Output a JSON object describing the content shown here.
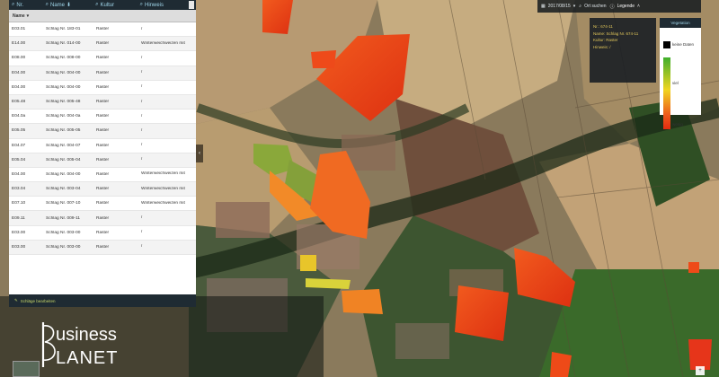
{
  "table": {
    "headers": {
      "id": "Nr.",
      "name": "Name",
      "crop": "Kultur",
      "note": "Hinweis"
    },
    "sub_header": "Name",
    "rows": [
      {
        "id": "E03.01",
        "name": "Schlag Nr. 183-01",
        "crop": "Raster",
        "note": "/"
      },
      {
        "id": "E14.00",
        "name": "Schlag Nr. 014-00",
        "crop": "Raster",
        "note": "Winterweichweizen mit"
      },
      {
        "id": "E08.00",
        "name": "Schlag Nr. 008-00",
        "crop": "Raster",
        "note": "/"
      },
      {
        "id": "E04.00",
        "name": "Schlag Nr. 004-00",
        "crop": "Raster",
        "note": "/"
      },
      {
        "id": "E04.00",
        "name": "Schlag Nr. 004-00",
        "crop": "Raster",
        "note": "/"
      },
      {
        "id": "E05.48",
        "name": "Schlag Nr. 005-48",
        "crop": "Raster",
        "note": "/"
      },
      {
        "id": "E04.0a",
        "name": "Schlag Nr. 004-0a",
        "crop": "Raster",
        "note": "/"
      },
      {
        "id": "E05.05",
        "name": "Schlag Nr. 005-05",
        "crop": "Raster",
        "note": "/"
      },
      {
        "id": "E04.07",
        "name": "Schlag Nr. 004-07",
        "crop": "Raster",
        "note": "/"
      },
      {
        "id": "E05.04",
        "name": "Schlag Nr. 005-04",
        "crop": "Raster",
        "note": "/"
      },
      {
        "id": "E04.00",
        "name": "Schlag Nr. 004-00",
        "crop": "Raster",
        "note": "Winterweichweizen mit"
      },
      {
        "id": "E03.04",
        "name": "Schlag Nr. 003-04",
        "crop": "Raster",
        "note": "Winterweichweizen mit"
      },
      {
        "id": "E07.10",
        "name": "Schlag Nr. 007-10",
        "crop": "Raster",
        "note": "Winterweichweizen mit"
      },
      {
        "id": "E09.11",
        "name": "Schlag Nr. 009-11",
        "crop": "Raster",
        "note": "/"
      },
      {
        "id": "E03.00",
        "name": "Schlag Nr. 003-00",
        "crop": "Raster",
        "note": "/"
      },
      {
        "id": "E03.00",
        "name": "Schlag Nr. 003-00",
        "crop": "Raster",
        "note": "/"
      }
    ],
    "footer": "Schläge bearbeiten"
  },
  "topbar": {
    "date": "2017/08/15",
    "search_placeholder": "Ort suchen",
    "legend_label": "Legende"
  },
  "info": {
    "id_line": "Nr.: 674-11",
    "name_line": "Name: Schlag Nr. 674-11",
    "crop_line": "Kultur: Raster",
    "note_line": "Hinweis: /"
  },
  "legend": {
    "title": "Vegetation",
    "no_clouds": "keine Daten",
    "high": "viel",
    "low": "wenig"
  },
  "brand": {
    "line1": "usiness",
    "line2": "LANET"
  },
  "colors": {
    "panel_dark": "#1f2b33",
    "accent_blue": "#9fd4e8",
    "field_orange": "#ef5d20",
    "field_red": "#e33512",
    "field_green": "#8aa83a",
    "info_gold": "#e2c75a"
  }
}
